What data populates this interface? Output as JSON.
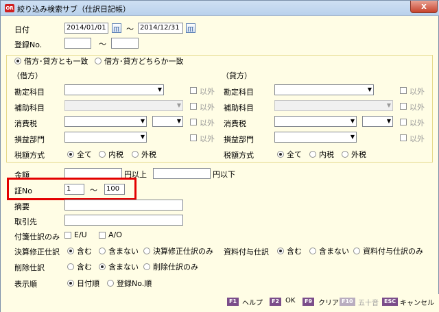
{
  "window": {
    "title": "絞り込み検索サブ（仕訳日記帳）",
    "app_icon": "OR",
    "close": "x"
  },
  "date": {
    "label": "日付",
    "from": "2014/01/01",
    "tilde": "～",
    "to": "2014/12/31"
  },
  "entry_no": {
    "label": "登録No.",
    "from": "",
    "tilde": "～",
    "to": ""
  },
  "match_mode": {
    "option1": "借方･貸方とも一致",
    "option2": "借方･貸方どちらか一致",
    "selected": "option1"
  },
  "debit": {
    "header": "（借方）",
    "account_label": "勘定科目",
    "sub_account_label": "補助科目",
    "tax_label": "消費税",
    "dept_label": "損益部門",
    "tax_method_label": "税額方式",
    "except_label": "以外",
    "tax_all": "全て",
    "tax_incl": "内税",
    "tax_excl": "外税"
  },
  "credit": {
    "header": "（貸方）",
    "account_label": "勘定科目",
    "sub_account_label": "補助科目",
    "tax_label": "消費税",
    "dept_label": "損益部門",
    "tax_method_label": "税額方式",
    "except_label": "以外",
    "tax_all": "全て",
    "tax_incl": "内税",
    "tax_excl": "外税"
  },
  "amount": {
    "label": "金額",
    "from": "",
    "above": "円以上",
    "to": "",
    "below": "円以下"
  },
  "voucher": {
    "label": "証No",
    "from": "1",
    "tilde": "～",
    "to": "100"
  },
  "summary": {
    "label": "摘要",
    "value": ""
  },
  "partner": {
    "label": "取引先",
    "value": ""
  },
  "attached_only": {
    "label": "付箋仕訳のみ",
    "eu": "E/U",
    "ao": "A/O"
  },
  "settlement": {
    "label": "決算修正仕訳",
    "include": "含む",
    "exclude": "含まない",
    "only": "決算修正仕訳のみ"
  },
  "document": {
    "label": "資料付与仕訳",
    "include": "含む",
    "exclude": "含まない",
    "only": "資料付与仕訳のみ"
  },
  "deleted": {
    "label": "削除仕訳",
    "include": "含む",
    "exclude": "含まない",
    "only": "削除仕訳のみ"
  },
  "order": {
    "label": "表示順",
    "by_date": "日付順",
    "by_entry": "登録No.順"
  },
  "fkeys": [
    {
      "key": "F1",
      "label": "ヘルプ"
    },
    {
      "key": "F2",
      "label": "OK"
    },
    {
      "key": "F9",
      "label": "クリア"
    },
    {
      "key": "F10",
      "label": "五十音"
    },
    {
      "key": "ESC",
      "label": "キャンセル"
    }
  ],
  "colors": {
    "background": "#FFFDE5",
    "highlight": "#E30000",
    "fkey": "#7B4D8A",
    "except_text": "#9A9A9A"
  }
}
